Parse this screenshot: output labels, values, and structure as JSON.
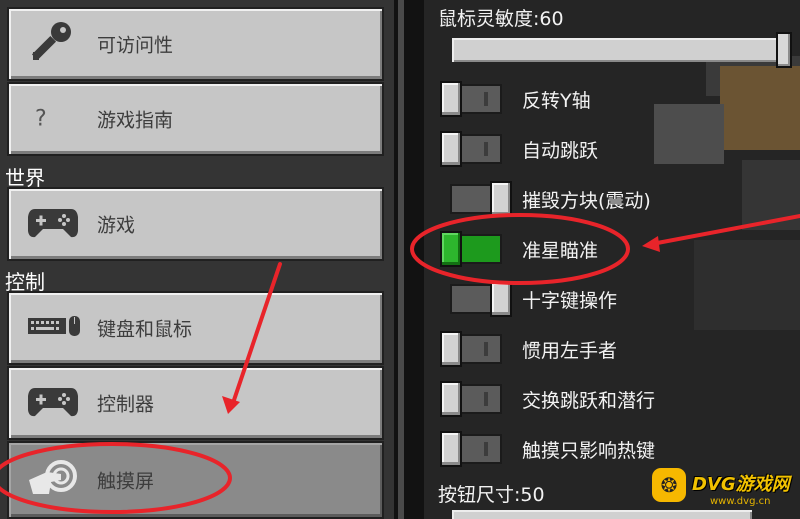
{
  "left_menu": {
    "top_items": [
      {
        "label": "可访问性",
        "icon": "key-icon"
      },
      {
        "label": "游戏指南",
        "icon": "question-icon",
        "glyph": "?"
      }
    ],
    "section_world": "世界",
    "world_items": [
      {
        "label": "游戏",
        "icon": "gamepad-icon"
      }
    ],
    "section_controls": "控制",
    "control_items": [
      {
        "label": "键盘和鼠标",
        "icon": "keyboard-mouse-icon"
      },
      {
        "label": "控制器",
        "icon": "gamepad-icon"
      },
      {
        "label": "触摸屏",
        "icon": "touch-hand-icon",
        "selected": true
      }
    ]
  },
  "settings": {
    "mouse_sensitivity": {
      "label": "鼠标灵敏度:60",
      "value": 60
    },
    "toggles": [
      {
        "label": "反转Y轴",
        "on": false
      },
      {
        "label": "自动跳跃",
        "on": false
      },
      {
        "label": "摧毁方块(震动)",
        "on": false
      },
      {
        "label": "准星瞄准",
        "on": true
      },
      {
        "label": "十字键操作",
        "on": false
      },
      {
        "label": "惯用左手者",
        "on": false
      },
      {
        "label": "交换跳跃和潜行",
        "on": false
      },
      {
        "label": "触摸只影响热键",
        "on": false
      }
    ],
    "button_size": {
      "label": "按钮尺寸:50",
      "value": 50
    }
  },
  "watermark": {
    "badge": "❂",
    "brand": "DVG游戏网",
    "url": "www.dvg.cn"
  },
  "colors": {
    "button_face": "#c6c6c6",
    "button_selected": "#8a8a8a",
    "toggle_on": "#1d9a1d",
    "annotation": "#e8242a"
  }
}
